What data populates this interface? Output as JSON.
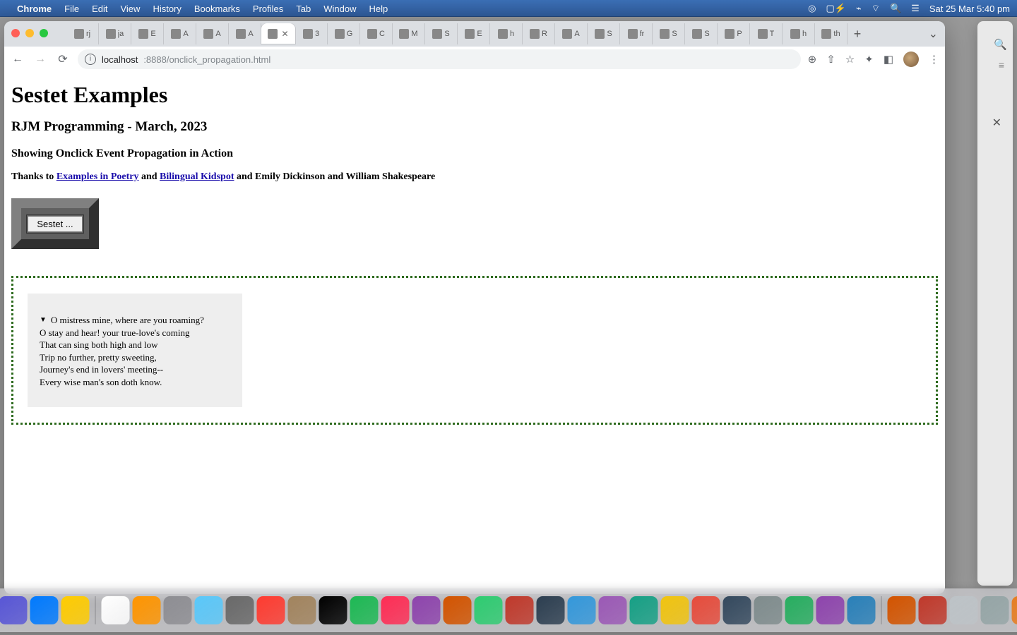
{
  "menubar": {
    "app": "Chrome",
    "items": [
      "File",
      "Edit",
      "View",
      "History",
      "Bookmarks",
      "Profiles",
      "Tab",
      "Window",
      "Help"
    ],
    "clock": "Sat 25 Mar  5:40 pm"
  },
  "chrome": {
    "tabs": [
      {
        "label": "rj"
      },
      {
        "label": "ja"
      },
      {
        "label": "E"
      },
      {
        "label": "A"
      },
      {
        "label": "A"
      },
      {
        "label": "A"
      },
      {
        "label": "",
        "active": true
      },
      {
        "label": "3"
      },
      {
        "label": "G"
      },
      {
        "label": "C"
      },
      {
        "label": "M"
      },
      {
        "label": "S"
      },
      {
        "label": "E"
      },
      {
        "label": "h"
      },
      {
        "label": "R"
      },
      {
        "label": "A"
      },
      {
        "label": "S"
      },
      {
        "label": "fr"
      },
      {
        "label": "S"
      },
      {
        "label": "S"
      },
      {
        "label": "P"
      },
      {
        "label": "T"
      },
      {
        "label": "h"
      },
      {
        "label": "th"
      }
    ],
    "tab_close_glyph": "✕",
    "newtab_glyph": "+",
    "overflow_glyph": "⌄",
    "nav": {
      "back": "←",
      "forward": "→",
      "reload": "⟳"
    },
    "omnibox": {
      "info_glyph": "i",
      "host": "localhost",
      "port_path": ":8888/onclick_propagation.html"
    },
    "addrright": {
      "zoom": "⊕",
      "install": "⇧",
      "star": "☆",
      "ext": "✦",
      "panel": "◧",
      "menu": "⋮"
    }
  },
  "page": {
    "h1": "Sestet Examples",
    "h2": "RJM Programming - March, 2023",
    "h3": "Showing Onclick Event Propagation in Action",
    "thanks_prefix": "Thanks to ",
    "link1": "Examples in Poetry",
    "thanks_mid": " and ",
    "link2": "Bilingual Kidspot",
    "thanks_suffix": " and Emily Dickinson and William Shakespeare",
    "sestet_button": "Sestet ...",
    "poem": {
      "line1": "O mistress mine, where are you roaming?",
      "line2": "O stay and hear! your true-love's coming",
      "line3": "That can sing both high and low",
      "line4": "Trip no further, pretty sweeting,",
      "line5": "Journey's end in lovers' meeting--",
      "line6": "Every wise man's son doth know.",
      "triangle": "▼"
    }
  },
  "bgwindow": {
    "close": "✕",
    "search": "🔍",
    "lines": "≡"
  },
  "menuicons": {
    "rec": "◎",
    "battery": "▢⚡",
    "bt": "⌁",
    "wifi": "⌔",
    "search": "🔍",
    "cc": "☰"
  },
  "dock_colors": [
    "#1e90ff",
    "#0a84ff",
    "#34c759",
    "#ff3b30",
    "#ff2d55",
    "#5856d6",
    "#007aff",
    "#ffcc00",
    "#ffffff",
    "#ff9500",
    "#8e8e93",
    "#5ac8fa",
    "#696969",
    "#ff3b30",
    "#a2845e",
    "#000000",
    "#1db954",
    "#ff2d55",
    "#8e44ad",
    "#d35400",
    "#2ecc71",
    "#c0392b",
    "#2c3e50",
    "#3498db",
    "#9b59b6",
    "#16a085",
    "#f1c40f",
    "#e74c3c",
    "#34495e",
    "#7f8c8d",
    "#27ae60",
    "#8e44ad",
    "#2980b9",
    "#d35400",
    "#c0392b",
    "#bdc3c7",
    "#95a5a6",
    "#e67e22",
    "#1abc9c",
    "#2c3e50",
    "#ff5e3a"
  ]
}
